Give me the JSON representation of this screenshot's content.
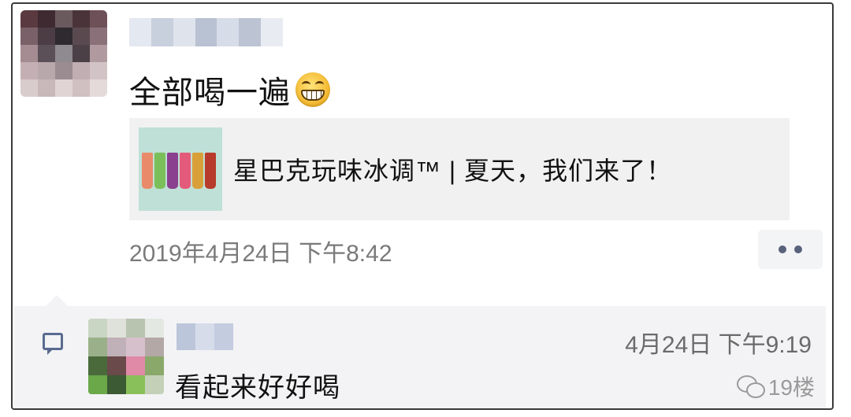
{
  "post": {
    "text": "全部喝一遍",
    "emoji_icon": "grinning-face-icon",
    "link_card": {
      "title": "星巴克玩味冰调™ | 夏天，我们来了！"
    },
    "timestamp": "2019年4月24日 下午8:42",
    "more_icon": "more-dots-icon"
  },
  "comment": {
    "icon": "comment-icon",
    "time": "4月24日 下午9:19",
    "text": "看起来好好喝"
  },
  "watermark": {
    "text": "19楼",
    "icon": "wechat-icon"
  },
  "colors": {
    "frame_border": "#3a3a3a",
    "card_bg": "#f1f1f1",
    "comment_bg": "#f3f3f5",
    "timestamp": "#7a7a7a",
    "link_blue": "#5a6a90"
  }
}
